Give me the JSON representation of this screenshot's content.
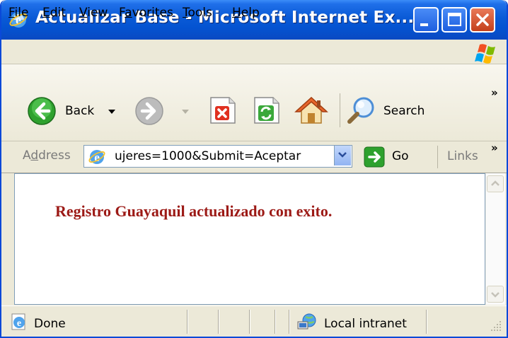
{
  "window": {
    "title": "Actualizar Base - Microsoft Internet Ex..."
  },
  "menu": {
    "items": [
      {
        "first": "F",
        "rest": "ile"
      },
      {
        "first": "E",
        "rest": "dit"
      },
      {
        "first": "V",
        "rest": "iew"
      },
      {
        "pre": "F",
        "first": "a",
        "rest": "vorites"
      },
      {
        "first": "T",
        "rest": "ools"
      },
      {
        "first": "H",
        "rest": "elp"
      }
    ]
  },
  "toolbar": {
    "back_label": "Back",
    "search_label": "Search",
    "chevron": "»"
  },
  "address": {
    "label_pre": "A",
    "label_u": "d",
    "label_rest": "dress",
    "value": "ujeres=1000&Submit=Aceptar",
    "go_label": "Go",
    "links_label": "Links",
    "chevron": "»"
  },
  "content": {
    "message": "Registro Guayaquil actualizado con exito."
  },
  "status": {
    "left_text": "Done",
    "zone_text": "Local intranet"
  },
  "colors": {
    "title_bar": "#0a5ad6",
    "message_text": "#9c1a16",
    "chrome": "#ece9d8"
  }
}
